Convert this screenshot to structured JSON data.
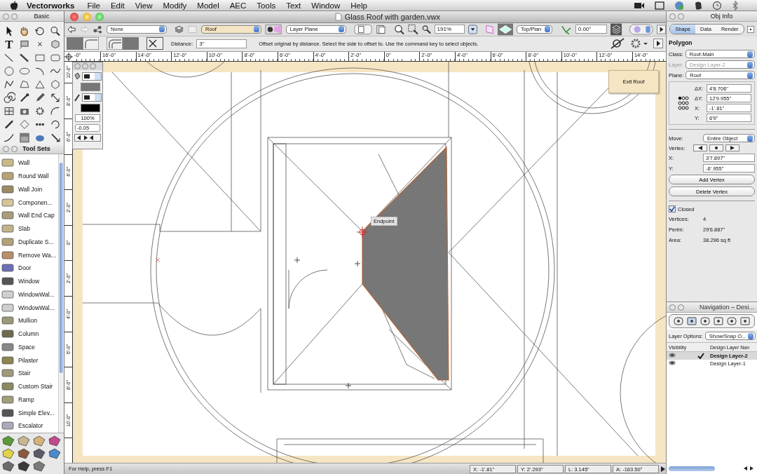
{
  "menu_bar": {
    "app": "Vectorworks",
    "items": [
      "File",
      "Edit",
      "View",
      "Modify",
      "Model",
      "AEC",
      "Tools",
      "Text",
      "Window",
      "Help"
    ]
  },
  "basic_palette": {
    "title": "Basic",
    "text_glyph": "T",
    "delete_glyph": "×"
  },
  "tool_sets": {
    "title": "Tool Sets",
    "items": [
      {
        "label": "Wall"
      },
      {
        "label": "Round Wall"
      },
      {
        "label": "Wall Join"
      },
      {
        "label": "Componen..."
      },
      {
        "label": "Wall End Cap"
      },
      {
        "label": "Slab"
      },
      {
        "label": "Duplicate S..."
      },
      {
        "label": "Remove Wa..."
      },
      {
        "label": "Door"
      },
      {
        "label": "Window"
      },
      {
        "label": "WindowWal..."
      },
      {
        "label": "WindowWal..."
      },
      {
        "label": "Mullion"
      },
      {
        "label": "Column"
      },
      {
        "label": "Space"
      },
      {
        "label": "Pilaster"
      },
      {
        "label": "Stair"
      },
      {
        "label": "Custom Stair"
      },
      {
        "label": "Ramp"
      },
      {
        "label": "Simple Elev..."
      },
      {
        "label": "Escalator"
      }
    ]
  },
  "document": {
    "title": "Glass Roof with garden.vwx",
    "toolbar": {
      "class": "None",
      "layer": "Roof",
      "plane": "Layer Plane",
      "zoom": "191%",
      "view": "Top/Plan",
      "rotation": "0.00°"
    },
    "mode_bar": {
      "distance_label": "Distance:",
      "distance": "3\"",
      "help": "Offset original by distance. Select the side to offset to. Use the command key to select objects."
    },
    "ruler": {
      "horizontal": [
        "-0\"",
        "16'-0\"",
        "14'-0\"",
        "12'-0\"",
        "10'-0\"",
        "8'-0\"",
        "6'-0\"",
        "4'-0\"",
        "2'-0\"",
        "0\"",
        "2'-0\"",
        "4'-0\"",
        "6'-0\"",
        "8'-0\"",
        "10'-0\"",
        "12'-0\"",
        "14'-0\""
      ],
      "vertical": [
        "10'-0\"",
        "8'-0\"",
        "6'-0\"",
        "4'-0\"",
        "2'-0\"",
        "0\"",
        "2'-0\"",
        "4'-0\"",
        "6'-0\"",
        "8'-0\"",
        "10'-0\""
      ]
    },
    "attributes": {
      "opacity": "100%",
      "line_weight": "-0.05"
    },
    "canvas": {
      "tooltip": "Endpoint",
      "exit_button": "Exit Roof"
    }
  },
  "status_bar": {
    "help": "For Help, press F1",
    "readouts": [
      "X: -1'.81\"",
      "Y: 2'.293\"",
      "L: 3.145\"",
      "A: -163.50°"
    ]
  },
  "obj_info": {
    "title": "Obj Info",
    "tabs": [
      {
        "label": "Shape",
        "selected": true
      },
      {
        "label": "Data",
        "selected": false
      },
      {
        "label": "Render",
        "selected": false
      }
    ],
    "object_type": "Polygon",
    "class": {
      "label": "Class:",
      "value": "Roof-Main",
      "disabled": false
    },
    "layer": {
      "label": "Layer:",
      "value": "Design Layer-2",
      "disabled": true
    },
    "plane": {
      "label": "Plane:",
      "value": "Roof",
      "disabled": false
    },
    "geometry": [
      {
        "label": "ΔX:",
        "value": "4'8.706\""
      },
      {
        "label": "ΔY:",
        "value": "12'9.955\""
      },
      {
        "label": "X:",
        "value": "-1'.81\""
      },
      {
        "label": "Y:",
        "value": "6'9\""
      }
    ],
    "move": {
      "label": "Move:",
      "value": "Entire Object"
    },
    "vertex_label": "Vertex:",
    "vertex": [
      {
        "label": "X:",
        "value": "3'7.897\""
      },
      {
        "label": "Y:",
        "value": "-6'.955\""
      }
    ],
    "buttons": [
      "Add Vertex",
      "Delete Vertex"
    ],
    "closed": {
      "label": "Closed",
      "checked": true
    },
    "info": [
      {
        "label": "Vertices:",
        "value": "4"
      },
      {
        "label": "Perim:",
        "value": "29'6.887\""
      },
      {
        "label": "Area:",
        "value": "38.296 sq ft"
      }
    ]
  },
  "navigation": {
    "title": "Navigation – Desi...",
    "layer_options_label": "Layer Options:",
    "layer_options": "Show/Snap O...",
    "columns": [
      "Visibility",
      "Design Layer Nan"
    ],
    "layers": [
      {
        "name": "Design Layer-2",
        "active": true,
        "selected": true
      },
      {
        "name": "Design Layer-1",
        "active": false,
        "selected": false
      }
    ]
  }
}
